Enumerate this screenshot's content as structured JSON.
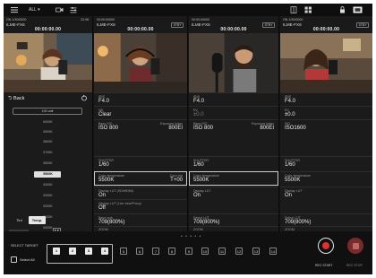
{
  "topbar": {
    "menu_icon": "hamburger-menu-icon",
    "view_label": "ALL ▾",
    "icon_refresh": "video-sync-icon",
    "icon_list": "list-adjust-icon",
    "right_icons": [
      "vertical-split-icon",
      "grid-view-icon",
      "lock-icon",
      "single-view-icon"
    ]
  },
  "cameras": [
    {
      "status": "ON 1/30/0000",
      "name": "ILME-FX6",
      "tc": "00:00:00.00",
      "rate": "23.98",
      "badge": ""
    },
    {
      "status": "00:00:00000",
      "name": "ILME-FX6",
      "tc": "00:00:00.00",
      "rate": "",
      "badge": "STBY"
    },
    {
      "status": "00:00:00000",
      "name": "ILME-FX6",
      "tc": "00:00:00.00",
      "rate": "",
      "badge": "STBY"
    },
    {
      "status": "ON 1/30/0000",
      "name": "ILME-FX6",
      "tc": "00:00:00.00",
      "rate": "",
      "badge": "STBY"
    }
  ],
  "panel2": {
    "iris_label": "IRIS",
    "iris_value": "F4.0",
    "nd_label": "ND",
    "nd_value": "Clear",
    "iso_label": "Base ISO",
    "iso_value": "ISO 800",
    "ei_label": "Exposure Index",
    "ei_value": "800EI",
    "shutter_label": "SHUTTER",
    "shutter_value": "1/60",
    "ct_label": "Color temperature",
    "ct_value": "5500K",
    "tint_label": "Color tint",
    "tint_value": "T+00",
    "lut_label": "Display LUT (SDI/HDMI)",
    "lut_value": "On",
    "lut2_label": "Display LUT (Live view/Proxy)",
    "lut2_value": "Off",
    "base_label": "Base look",
    "base_value": "709(800%)",
    "zoom_label": "ZOOM"
  },
  "panel3": {
    "iris_label": "IRIS",
    "iris_value": "F4.0",
    "ev_label": "EV",
    "ev_value": "±0.0",
    "iso_label": "Base ISO",
    "iso_value": "ISO 800",
    "ei_label": "Exposure Index",
    "ei_value": "800EI",
    "shutter_label": "SHUTTER",
    "shutter_value": "1/60",
    "ct_label": "Color temperature",
    "ct_value": "5500K",
    "lut_label": "Display LUT",
    "lut_value": "On",
    "sel_label": "Select LUT",
    "sel_value": "709(800%)",
    "zoom_label": "ZOOM"
  },
  "panel4": {
    "iris_label": "IRIS",
    "iris_value": "F4.0",
    "ev_label": "EV",
    "ev_value": "±0.0",
    "iso_label": "ISO",
    "iso_value": "ISO1600",
    "shutter_label": "SHUTTER",
    "shutter_value": "1/60",
    "ct_label": "Color temperature",
    "ct_value": "5500K",
    "lut_label": "Display LUT",
    "lut_value": "On",
    "sel_label": "Select LUT",
    "sel_value": "709(800%)",
    "zoom_label": "ZOOM"
  },
  "picker": {
    "back_label": "Back",
    "field_value": "100 unit",
    "items": [
      "6000K",
      "5900K",
      "5800K",
      "5700K",
      "5600K",
      "5500K",
      "5400K",
      "5300K",
      "5200K",
      "5100K",
      "5000K"
    ],
    "selected": "5500K",
    "seg_tint": "Tint",
    "seg_temp": "Temp.",
    "manual_label": "Manual"
  },
  "bottom": {
    "select_target_label": "SELECT TARGET",
    "select_all_label": "Select All",
    "numbers": [
      "1",
      "2",
      "3",
      "4",
      "5",
      "6",
      "7",
      "8",
      "9",
      "10",
      "11",
      "12",
      "13",
      "14"
    ],
    "rec_start_label": "REC START",
    "rec_stop_label": "REC STOP"
  },
  "colors": {
    "rec": "#e23030",
    "stop": "#7a2a2a",
    "panel": "#1b1b1b"
  }
}
